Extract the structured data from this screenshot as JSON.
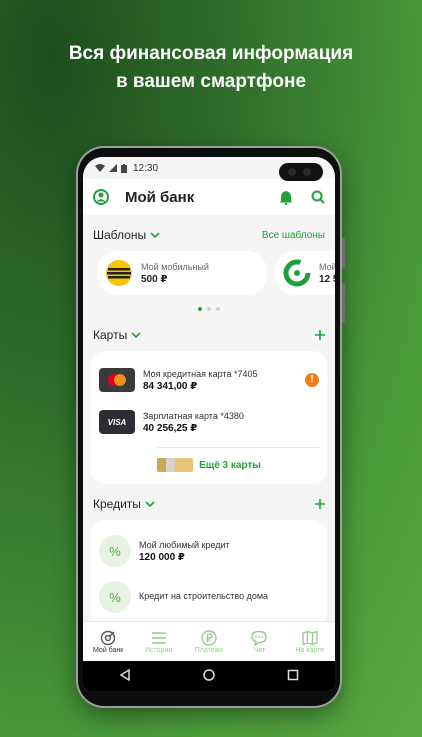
{
  "promo": {
    "line1": "Вся финансовая информация",
    "line2": "в вашем смартфоне"
  },
  "status": {
    "time": "12:30"
  },
  "header": {
    "title": "Мой банк",
    "profile_icon": "profile-icon",
    "bell_icon": "bell-icon",
    "search_icon": "search-icon"
  },
  "templates": {
    "title": "Шаблоны",
    "all_link": "Все шаблоны",
    "items": [
      {
        "name": "Мой мобильный",
        "amount": "500 ₽",
        "logo_color": "#f7c600"
      },
      {
        "name": "Мой",
        "amount": "12 5",
        "logo_color": "#21a038"
      }
    ],
    "pager": {
      "pages": 3,
      "active": 1
    }
  },
  "cards": {
    "title": "Карты",
    "items": [
      {
        "name": "Моя кредитная карта *7405",
        "amount": "84 341,00 ₽",
        "type": "mastercard",
        "alert": "!"
      },
      {
        "name": "Зарплатная карта *4380",
        "amount": "40 256,25 ₽",
        "type": "visa",
        "type_label": "VISA"
      }
    ],
    "more_label": "Ещё 3 карты"
  },
  "credits": {
    "title": "Кредиты",
    "items": [
      {
        "name": "Мой любимый кредит",
        "amount": "120 000 ₽",
        "icon": "percent-icon"
      },
      {
        "name": "Кредит на строительство дома",
        "amount": "",
        "icon": "percent-icon"
      }
    ]
  },
  "tabbar": [
    {
      "label": "Мой банк",
      "icon": "home-icon",
      "active": true
    },
    {
      "label": "История",
      "icon": "history-icon",
      "active": false
    },
    {
      "label": "Платежи",
      "icon": "ruble-icon",
      "active": false
    },
    {
      "label": "Чат",
      "icon": "chat-icon",
      "active": false
    },
    {
      "label": "На карте",
      "icon": "map-icon",
      "active": false
    }
  ],
  "colors": {
    "accent": "#21a038",
    "warning": "#f07c1e",
    "background": "#f4f5f4"
  }
}
